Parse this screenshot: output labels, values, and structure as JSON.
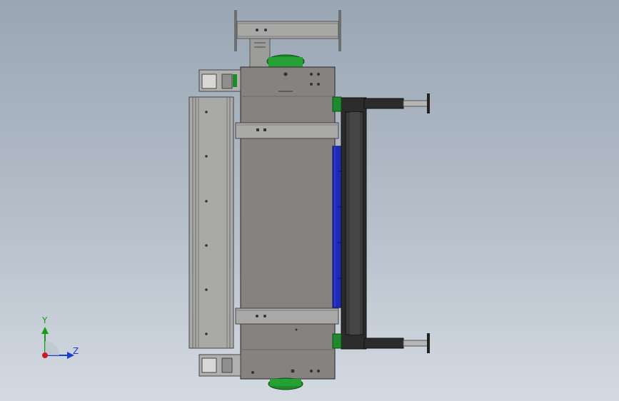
{
  "view": {
    "background_top": "#9aa6b4",
    "background_bottom": "#d4dae2"
  },
  "parts": {
    "steel_color": "#8a8784",
    "frame_color": "#a9aaa8",
    "dark_color": "#2a2a2a",
    "blue_color": "#1f2ab8",
    "green_color": "#1e8a2c"
  },
  "triad": {
    "axis_y_label": "Y",
    "axis_z_label": "Z",
    "y_color": "#1a9a1a",
    "z_color": "#1a3fd0",
    "x_color": "#d01a1a"
  }
}
